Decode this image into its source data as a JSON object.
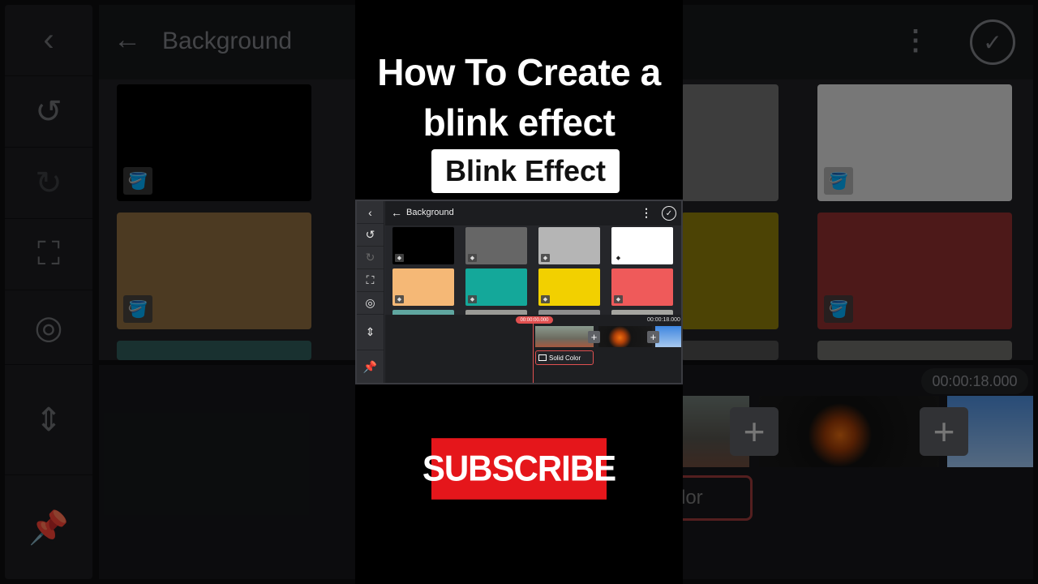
{
  "video": {
    "headline": "How To Create a blink effect",
    "badge": "Blink Effect",
    "cta": "SUBSCRIBE"
  },
  "editor": {
    "title": "Background",
    "more_icon": "more-vert-icon",
    "confirm_icon": "check-circle-icon",
    "back_icon": "arrow-left-icon",
    "rail": [
      {
        "name": "back",
        "icon": "chevron-left-icon",
        "glyph": "‹"
      },
      {
        "name": "undo",
        "icon": "undo-icon",
        "glyph": "↺"
      },
      {
        "name": "redo",
        "icon": "redo-icon",
        "glyph": "↻"
      },
      {
        "name": "fit",
        "icon": "fit-screen-icon",
        "glyph": "⛶"
      },
      {
        "name": "settings",
        "icon": "gear-icon",
        "glyph": "◎"
      },
      {
        "name": "split",
        "icon": "split-track-icon",
        "glyph": "⇕"
      },
      {
        "name": "pin",
        "icon": "pin-icon",
        "glyph": "📌"
      }
    ],
    "swatches": [
      "#000000",
      "#666666",
      "#b5b5b5",
      "#ffffff",
      "#f5b876",
      "#14a89a",
      "#f2d000",
      "#ef5a5a"
    ],
    "paint_icon": "paint-bucket-icon",
    "playhead_time": "00:00:00.000",
    "end_time": "00:00:18.000",
    "solid_color_label": "Solid Color",
    "add_icon": "plus-icon"
  },
  "background_echo": {
    "title": "Background",
    "end_time": "00:00:18.000",
    "clip_label_fragment": "lor"
  },
  "colors": {
    "accent_red": "#e05050",
    "subscribe_red": "#e5161b"
  }
}
